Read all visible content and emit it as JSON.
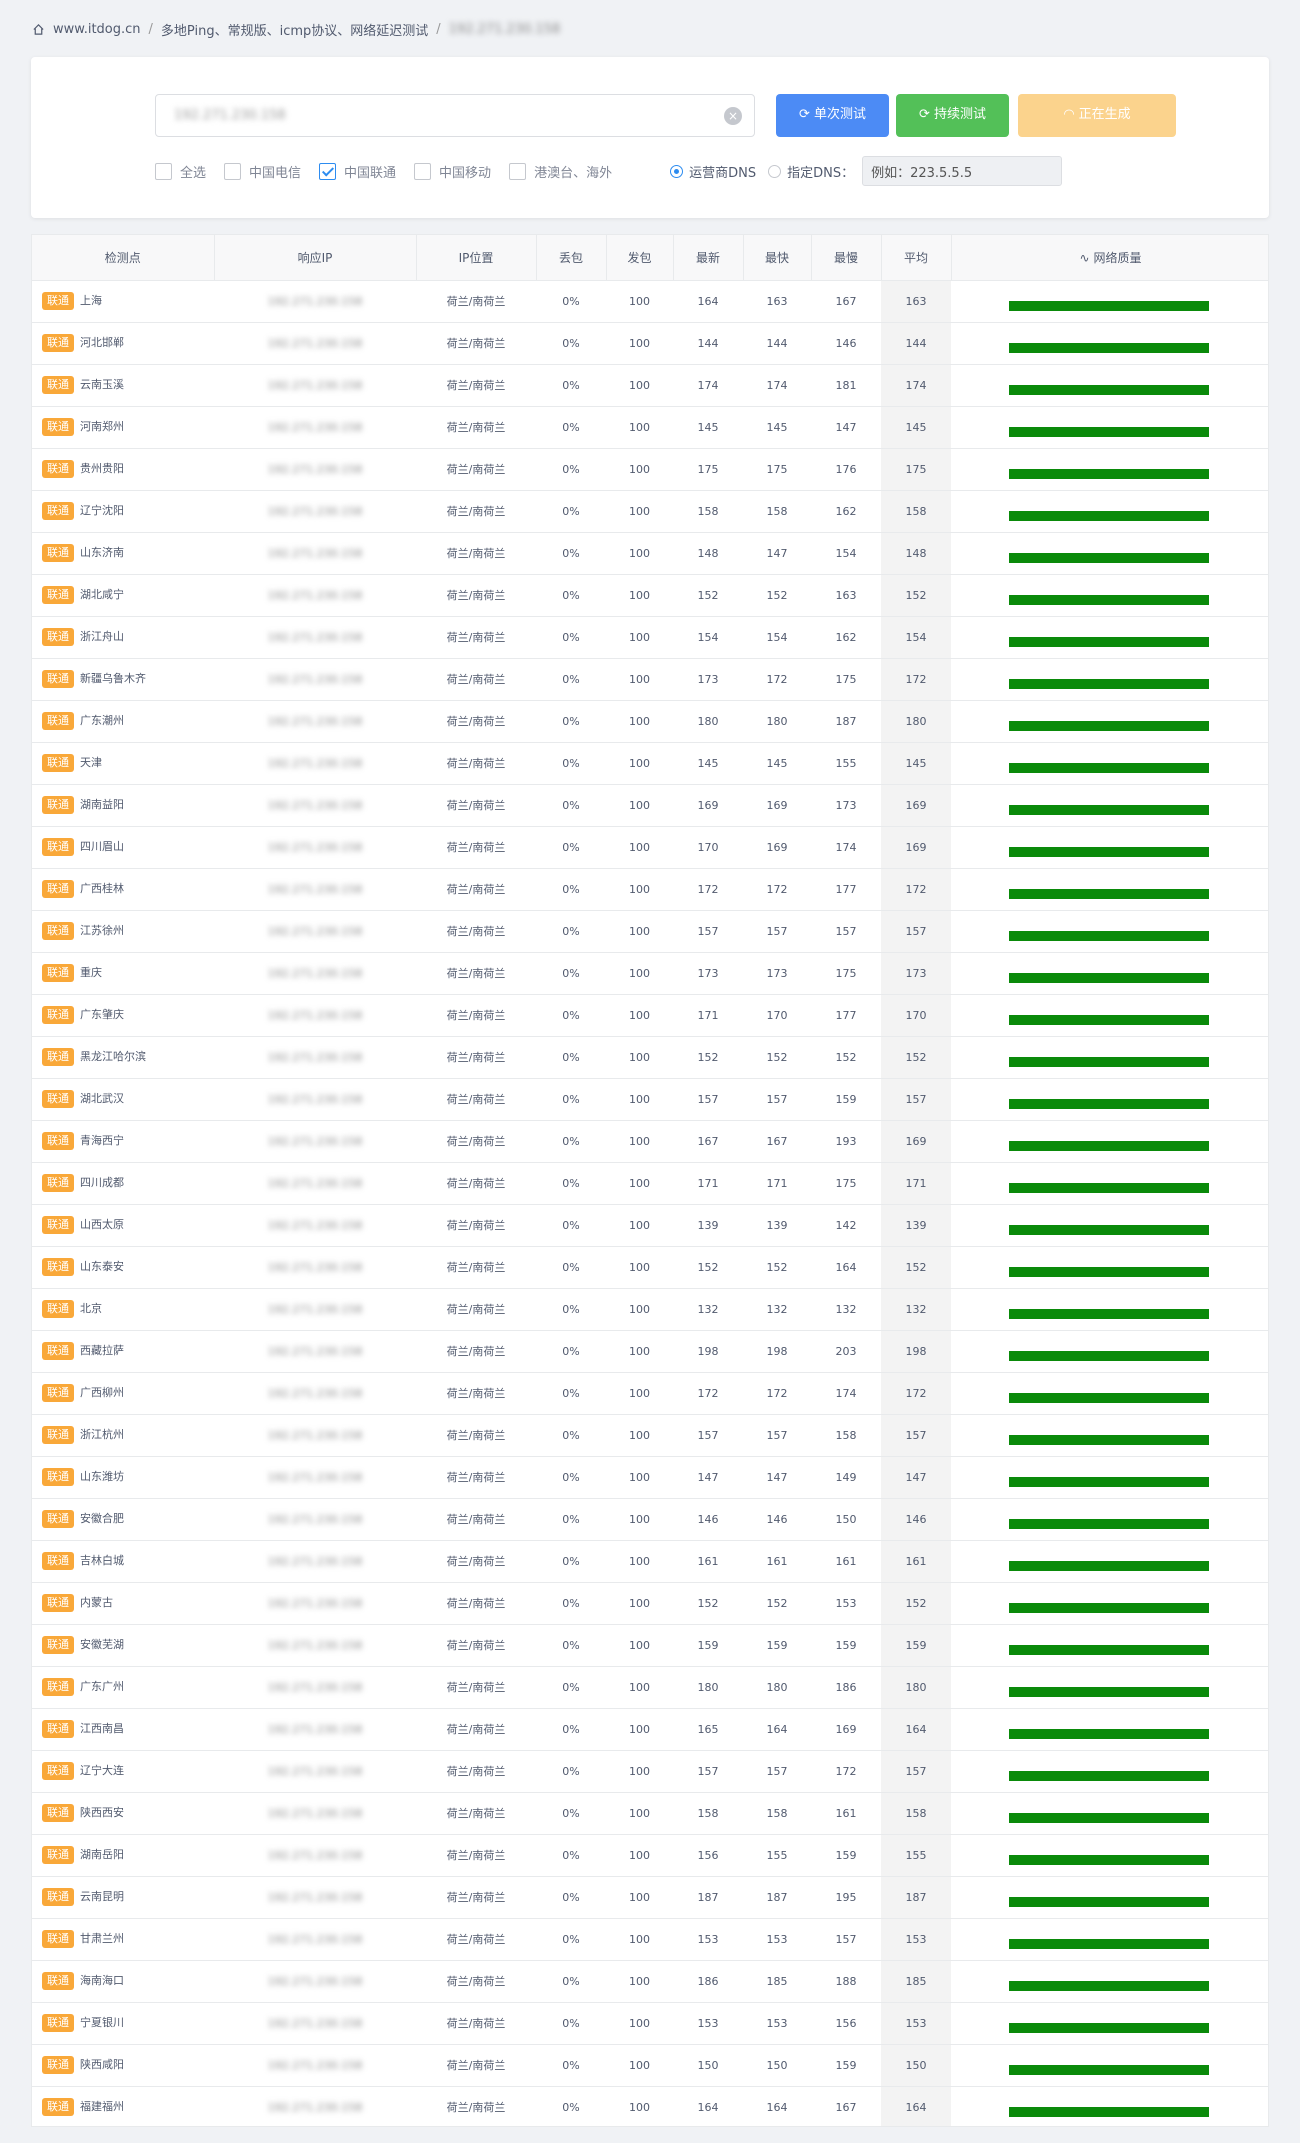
{
  "breadcrumb": {
    "site": "www.itdog.cn",
    "page": "多地Ping、常规版、icmp协议、网络延迟测试",
    "target": "192.271.230.158"
  },
  "search": {
    "value": "192.271.230.158",
    "placeholder": ""
  },
  "buttons": {
    "single": "单次测试",
    "continuous": "持续测试",
    "generating": "正在生成"
  },
  "filters": {
    "all": "全选",
    "telecom": "中国电信",
    "unicom": "中国联通",
    "mobile": "中国移动",
    "overseas": "港澳台、海外",
    "unicom_checked": true
  },
  "dns": {
    "carrier_label": "运营商DNS",
    "custom_label": "指定DNS：",
    "placeholder": "例如：223.5.5.5"
  },
  "table": {
    "headers": [
      "检测点",
      "响应IP",
      "IP位置",
      "丢包",
      "发包",
      "最新",
      "最快",
      "最慢",
      "平均",
      "网络质量"
    ],
    "isp_tag": "联通",
    "ip_blurred": "192.271.230.158",
    "location": "荷兰/南荷兰",
    "rows": [
      {
        "node": "上海",
        "loss": "0%",
        "sent": "100",
        "latest": "164",
        "fastest": "163",
        "slowest": "167",
        "avg": "163"
      },
      {
        "node": "河北邯郸",
        "loss": "0%",
        "sent": "100",
        "latest": "144",
        "fastest": "144",
        "slowest": "146",
        "avg": "144"
      },
      {
        "node": "云南玉溪",
        "loss": "0%",
        "sent": "100",
        "latest": "174",
        "fastest": "174",
        "slowest": "181",
        "avg": "174"
      },
      {
        "node": "河南郑州",
        "loss": "0%",
        "sent": "100",
        "latest": "145",
        "fastest": "145",
        "slowest": "147",
        "avg": "145"
      },
      {
        "node": "贵州贵阳",
        "loss": "0%",
        "sent": "100",
        "latest": "175",
        "fastest": "175",
        "slowest": "176",
        "avg": "175"
      },
      {
        "node": "辽宁沈阳",
        "loss": "0%",
        "sent": "100",
        "latest": "158",
        "fastest": "158",
        "slowest": "162",
        "avg": "158"
      },
      {
        "node": "山东济南",
        "loss": "0%",
        "sent": "100",
        "latest": "148",
        "fastest": "147",
        "slowest": "154",
        "avg": "148"
      },
      {
        "node": "湖北咸宁",
        "loss": "0%",
        "sent": "100",
        "latest": "152",
        "fastest": "152",
        "slowest": "163",
        "avg": "152"
      },
      {
        "node": "浙江舟山",
        "loss": "0%",
        "sent": "100",
        "latest": "154",
        "fastest": "154",
        "slowest": "162",
        "avg": "154"
      },
      {
        "node": "新疆乌鲁木齐",
        "loss": "0%",
        "sent": "100",
        "latest": "173",
        "fastest": "172",
        "slowest": "175",
        "avg": "172"
      },
      {
        "node": "广东潮州",
        "loss": "0%",
        "sent": "100",
        "latest": "180",
        "fastest": "180",
        "slowest": "187",
        "avg": "180"
      },
      {
        "node": "天津",
        "loss": "0%",
        "sent": "100",
        "latest": "145",
        "fastest": "145",
        "slowest": "155",
        "avg": "145"
      },
      {
        "node": "湖南益阳",
        "loss": "0%",
        "sent": "100",
        "latest": "169",
        "fastest": "169",
        "slowest": "173",
        "avg": "169"
      },
      {
        "node": "四川眉山",
        "loss": "0%",
        "sent": "100",
        "latest": "170",
        "fastest": "169",
        "slowest": "174",
        "avg": "169"
      },
      {
        "node": "广西桂林",
        "loss": "0%",
        "sent": "100",
        "latest": "172",
        "fastest": "172",
        "slowest": "177",
        "avg": "172"
      },
      {
        "node": "江苏徐州",
        "loss": "0%",
        "sent": "100",
        "latest": "157",
        "fastest": "157",
        "slowest": "157",
        "avg": "157"
      },
      {
        "node": "重庆",
        "loss": "0%",
        "sent": "100",
        "latest": "173",
        "fastest": "173",
        "slowest": "175",
        "avg": "173"
      },
      {
        "node": "广东肇庆",
        "loss": "0%",
        "sent": "100",
        "latest": "171",
        "fastest": "170",
        "slowest": "177",
        "avg": "170"
      },
      {
        "node": "黑龙江哈尔滨",
        "loss": "0%",
        "sent": "100",
        "latest": "152",
        "fastest": "152",
        "slowest": "152",
        "avg": "152"
      },
      {
        "node": "湖北武汉",
        "loss": "0%",
        "sent": "100",
        "latest": "157",
        "fastest": "157",
        "slowest": "159",
        "avg": "157"
      },
      {
        "node": "青海西宁",
        "loss": "0%",
        "sent": "100",
        "latest": "167",
        "fastest": "167",
        "slowest": "193",
        "avg": "169"
      },
      {
        "node": "四川成都",
        "loss": "0%",
        "sent": "100",
        "latest": "171",
        "fastest": "171",
        "slowest": "175",
        "avg": "171"
      },
      {
        "node": "山西太原",
        "loss": "0%",
        "sent": "100",
        "latest": "139",
        "fastest": "139",
        "slowest": "142",
        "avg": "139"
      },
      {
        "node": "山东泰安",
        "loss": "0%",
        "sent": "100",
        "latest": "152",
        "fastest": "152",
        "slowest": "164",
        "avg": "152"
      },
      {
        "node": "北京",
        "loss": "0%",
        "sent": "100",
        "latest": "132",
        "fastest": "132",
        "slowest": "132",
        "avg": "132"
      },
      {
        "node": "西藏拉萨",
        "loss": "0%",
        "sent": "100",
        "latest": "198",
        "fastest": "198",
        "slowest": "203",
        "avg": "198"
      },
      {
        "node": "广西柳州",
        "loss": "0%",
        "sent": "100",
        "latest": "172",
        "fastest": "172",
        "slowest": "174",
        "avg": "172"
      },
      {
        "node": "浙江杭州",
        "loss": "0%",
        "sent": "100",
        "latest": "157",
        "fastest": "157",
        "slowest": "158",
        "avg": "157"
      },
      {
        "node": "山东潍坊",
        "loss": "0%",
        "sent": "100",
        "latest": "147",
        "fastest": "147",
        "slowest": "149",
        "avg": "147"
      },
      {
        "node": "安徽合肥",
        "loss": "0%",
        "sent": "100",
        "latest": "146",
        "fastest": "146",
        "slowest": "150",
        "avg": "146"
      },
      {
        "node": "吉林白城",
        "loss": "0%",
        "sent": "100",
        "latest": "161",
        "fastest": "161",
        "slowest": "161",
        "avg": "161"
      },
      {
        "node": "内蒙古",
        "loss": "0%",
        "sent": "100",
        "latest": "152",
        "fastest": "152",
        "slowest": "153",
        "avg": "152"
      },
      {
        "node": "安徽芜湖",
        "loss": "0%",
        "sent": "100",
        "latest": "159",
        "fastest": "159",
        "slowest": "159",
        "avg": "159"
      },
      {
        "node": "广东广州",
        "loss": "0%",
        "sent": "100",
        "latest": "180",
        "fastest": "180",
        "slowest": "186",
        "avg": "180"
      },
      {
        "node": "江西南昌",
        "loss": "0%",
        "sent": "100",
        "latest": "165",
        "fastest": "164",
        "slowest": "169",
        "avg": "164"
      },
      {
        "node": "辽宁大连",
        "loss": "0%",
        "sent": "100",
        "latest": "157",
        "fastest": "157",
        "slowest": "172",
        "avg": "157"
      },
      {
        "node": "陕西西安",
        "loss": "0%",
        "sent": "100",
        "latest": "158",
        "fastest": "158",
        "slowest": "161",
        "avg": "158"
      },
      {
        "node": "湖南岳阳",
        "loss": "0%",
        "sent": "100",
        "latest": "156",
        "fastest": "155",
        "slowest": "159",
        "avg": "155"
      },
      {
        "node": "云南昆明",
        "loss": "0%",
        "sent": "100",
        "latest": "187",
        "fastest": "187",
        "slowest": "195",
        "avg": "187"
      },
      {
        "node": "甘肃兰州",
        "loss": "0%",
        "sent": "100",
        "latest": "153",
        "fastest": "153",
        "slowest": "157",
        "avg": "153"
      },
      {
        "node": "海南海口",
        "loss": "0%",
        "sent": "100",
        "latest": "186",
        "fastest": "185",
        "slowest": "188",
        "avg": "185"
      },
      {
        "node": "宁夏银川",
        "loss": "0%",
        "sent": "100",
        "latest": "153",
        "fastest": "153",
        "slowest": "156",
        "avg": "153"
      },
      {
        "node": "陕西咸阳",
        "loss": "0%",
        "sent": "100",
        "latest": "150",
        "fastest": "150",
        "slowest": "159",
        "avg": "150"
      },
      {
        "node": "福建福州",
        "loss": "0%",
        "sent": "100",
        "latest": "164",
        "fastest": "164",
        "slowest": "167",
        "avg": "164"
      }
    ]
  },
  "colors": {
    "tag": "#f9a839",
    "quality_bar": "#0a8a0a",
    "btn_single": "#4c8bf5",
    "btn_continuous": "#53c058",
    "btn_generating": "#fbd38d"
  }
}
